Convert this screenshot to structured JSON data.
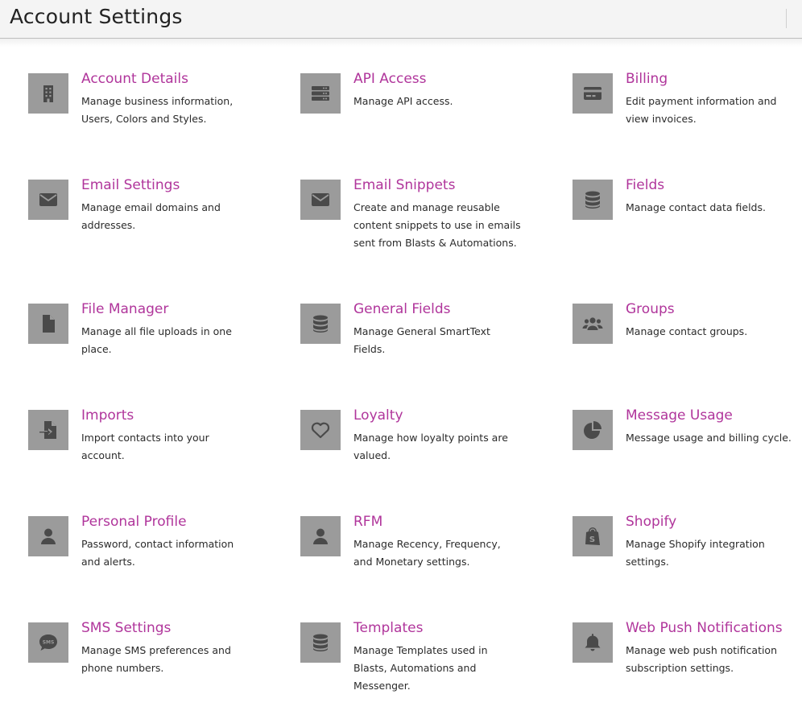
{
  "header": {
    "title": "Account Settings"
  },
  "cards": [
    {
      "title": "Account Details",
      "desc": "Manage business information, Users, Colors and Styles.",
      "icon": "building-icon"
    },
    {
      "title": "API Access",
      "desc": "Manage API access.",
      "icon": "server-icon"
    },
    {
      "title": "Billing",
      "desc": "Edit payment information and view invoices.",
      "icon": "credit-card-icon"
    },
    {
      "title": "Email Settings",
      "desc": "Manage email domains and addresses.",
      "icon": "envelope-icon"
    },
    {
      "title": "Email Snippets",
      "desc": "Create and manage reusable content snippets to use in emails sent from Blasts & Automations.",
      "icon": "envelope-icon"
    },
    {
      "title": "Fields",
      "desc": "Manage contact data fields.",
      "icon": "database-icon"
    },
    {
      "title": "File Manager",
      "desc": "Manage all file uploads in one place.",
      "icon": "file-icon"
    },
    {
      "title": "General Fields",
      "desc": "Manage General SmartText Fields.",
      "icon": "database-icon"
    },
    {
      "title": "Groups",
      "desc": "Manage contact groups.",
      "icon": "users-icon"
    },
    {
      "title": "Imports",
      "desc": "Import contacts into your account.",
      "icon": "file-import-icon"
    },
    {
      "title": "Loyalty",
      "desc": "Manage how loyalty points are valued.",
      "icon": "heart-icon"
    },
    {
      "title": "Message Usage",
      "desc": "Message usage and billing cycle.",
      "icon": "pie-chart-icon"
    },
    {
      "title": "Personal Profile",
      "desc": "Password, contact information and alerts.",
      "icon": "user-icon"
    },
    {
      "title": "RFM",
      "desc": "Manage Recency, Frequency, and Monetary settings.",
      "icon": "user-icon"
    },
    {
      "title": "Shopify",
      "desc": "Manage Shopify integration settings.",
      "icon": "shopify-icon"
    },
    {
      "title": "SMS Settings",
      "desc": "Manage SMS preferences and phone numbers.",
      "icon": "sms-icon"
    },
    {
      "title": "Templates",
      "desc": "Manage Templates used in Blasts, Automations and Messenger.",
      "icon": "database-icon"
    },
    {
      "title": "Web Push Notifications",
      "desc": "Manage web push notification subscription settings.",
      "icon": "bell-icon"
    }
  ],
  "colors": {
    "title": "#b0359b",
    "icon_bg": "#9b9b9b",
    "icon_fg": "#4a4a4a"
  }
}
